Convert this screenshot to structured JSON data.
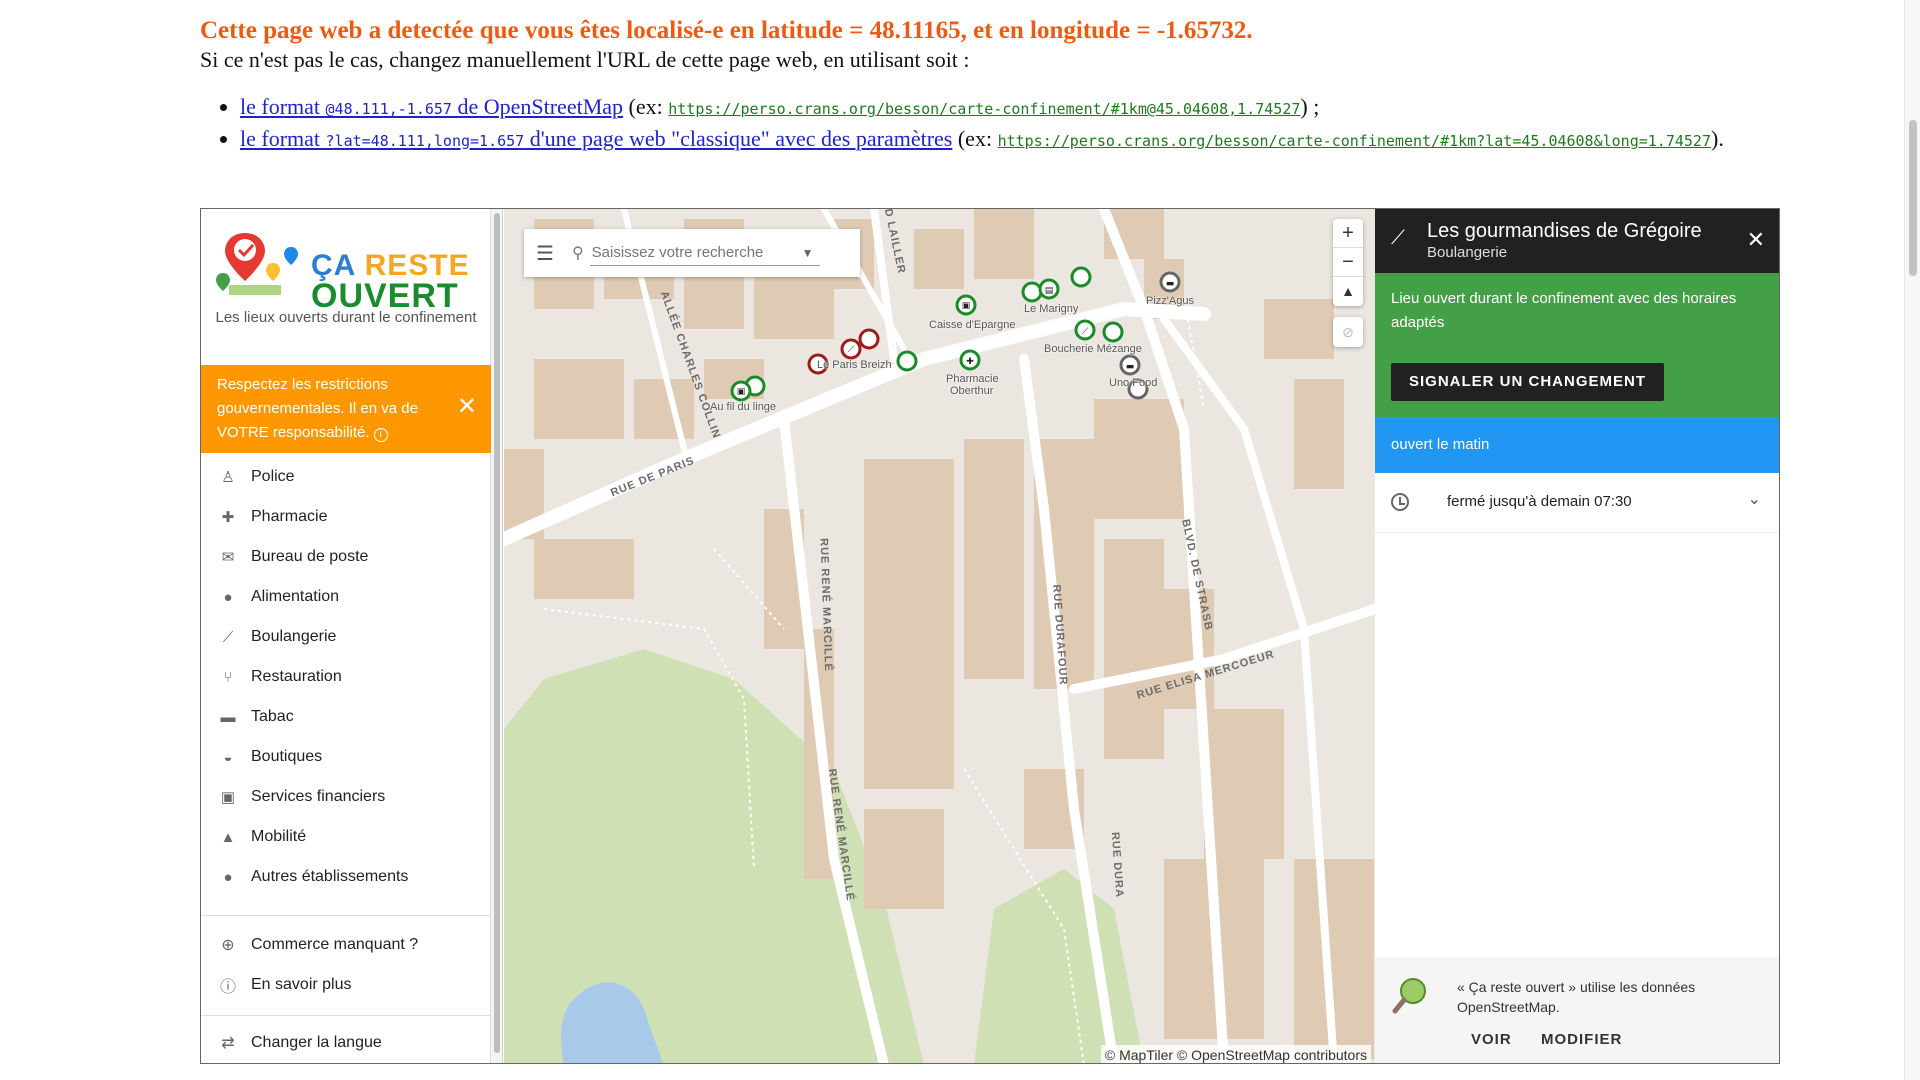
{
  "header": {
    "title": "Cette page web a detectée que vous êtes localisé-e en latitude = 48.11165, et en longitude = -1.65732.",
    "subtitle": "Si ce n'est pas le cas, changez manuellement l'URL de cette page web, en utilisant soit :",
    "format1_prefix": "le format ",
    "format1_code": "@48.111,-1.657",
    "format1_suffix": " de OpenStreetMap",
    "format1_ex_open": " (ex: ",
    "format1_url": "https://perso.crans.org/besson/carte-confinement/#1km@45.04608,1.74527",
    "format1_ex_close": ") ;",
    "format2_prefix": "le format ",
    "format2_code": "?lat=48.111,long=1.657",
    "format2_suffix": " d'une page web \"classique\" avec des paramètres",
    "format2_ex_open": " (ex: ",
    "format2_url": "https://perso.crans.org/besson/carte-confinement/#1km?lat=45.04608&long=1.74527",
    "format2_ex_close": ")."
  },
  "sidebar": {
    "logo_line1a": "ÇA ",
    "logo_line1b": "RESTE",
    "logo_line2": "OUVERT",
    "tagline": "Les lieux ouverts durant le confinement",
    "warning": "Respectez les restrictions gouvernementales. Il en va de VOTRE responsabilité.",
    "categories": [
      {
        "label": "Police",
        "icon": "police-icon"
      },
      {
        "label": "Pharmacie",
        "icon": "pharmacy-icon"
      },
      {
        "label": "Bureau de poste",
        "icon": "mail-icon"
      },
      {
        "label": "Alimentation",
        "icon": "food-icon"
      },
      {
        "label": "Boulangerie",
        "icon": "bread-icon"
      },
      {
        "label": "Restauration",
        "icon": "restaurant-icon"
      },
      {
        "label": "Tabac",
        "icon": "tobacco-icon"
      },
      {
        "label": "Boutiques",
        "icon": "basket-icon"
      },
      {
        "label": "Services financiers",
        "icon": "money-icon"
      },
      {
        "label": "Mobilité",
        "icon": "road-icon"
      },
      {
        "label": "Autres établissements",
        "icon": "pin-icon"
      }
    ],
    "missing_shop": "Commerce manquant ?",
    "learn_more": "En savoir plus",
    "change_language": "Changer la langue"
  },
  "search": {
    "placeholder": "Saisissez votre recherche"
  },
  "map": {
    "zoom_in": "+",
    "zoom_out": "−",
    "north": "▲",
    "attribution": "© MapTiler © OpenStreetMap contributors",
    "streets": {
      "rue_de_paris": "RUE DE PARIS",
      "allee_charles_collin": "ALLÉE CHARLES COLLIN",
      "rue_rene_marcille_1": "RUE RENÉ MARCILLÉ",
      "rue_rene_marcille_2": "RUE RENÉ MARCILLÉ",
      "rue_durafour_1": "RUE DURAFOUR",
      "rue_durafour_2": "RUE DURA",
      "rue_elisa_mercoeur": "RUE ELISA MERCOEUR",
      "bld_strasbourg": "BLVD. DE STRASB",
      "lailler": "ND LAILLER"
    },
    "poi_labels": {
      "au_fil_du_linge": "Au fil du linge",
      "le_paris_breizh": "Le Paris Breizh",
      "caisse_epargne": "Caisse d'Epargne",
      "pharmacie_oberthur_1": "Pharmacie",
      "pharmacie_oberthur_2": "Oberthur",
      "le_marigny": "Le Marigny",
      "boucherie_mezange": "Boucherie Mézange",
      "uno_food": "Uno Food",
      "pizz_agus": "Pizz'Agus"
    },
    "colors": {
      "open": "#1b8a2a",
      "closed": "#9b1c1c",
      "unknown": "#666666",
      "water": "#a9c9e8",
      "park": "#cfe0b4",
      "building": "#dfcbb3"
    }
  },
  "panel": {
    "name": "Les gourmandises de Grégoire",
    "category": "Boulangerie",
    "status": "Lieu ouvert durant le confinement avec des horaires adaptés",
    "report_button": "SIGNALER UN CHANGEMENT",
    "open_info": "ouvert le matin",
    "hours": "fermé jusqu'à demain 07:30",
    "footer_text": "« Ça reste ouvert » utilise les données OpenStreetMap.",
    "view": "VOIR",
    "edit": "MODIFIER"
  }
}
